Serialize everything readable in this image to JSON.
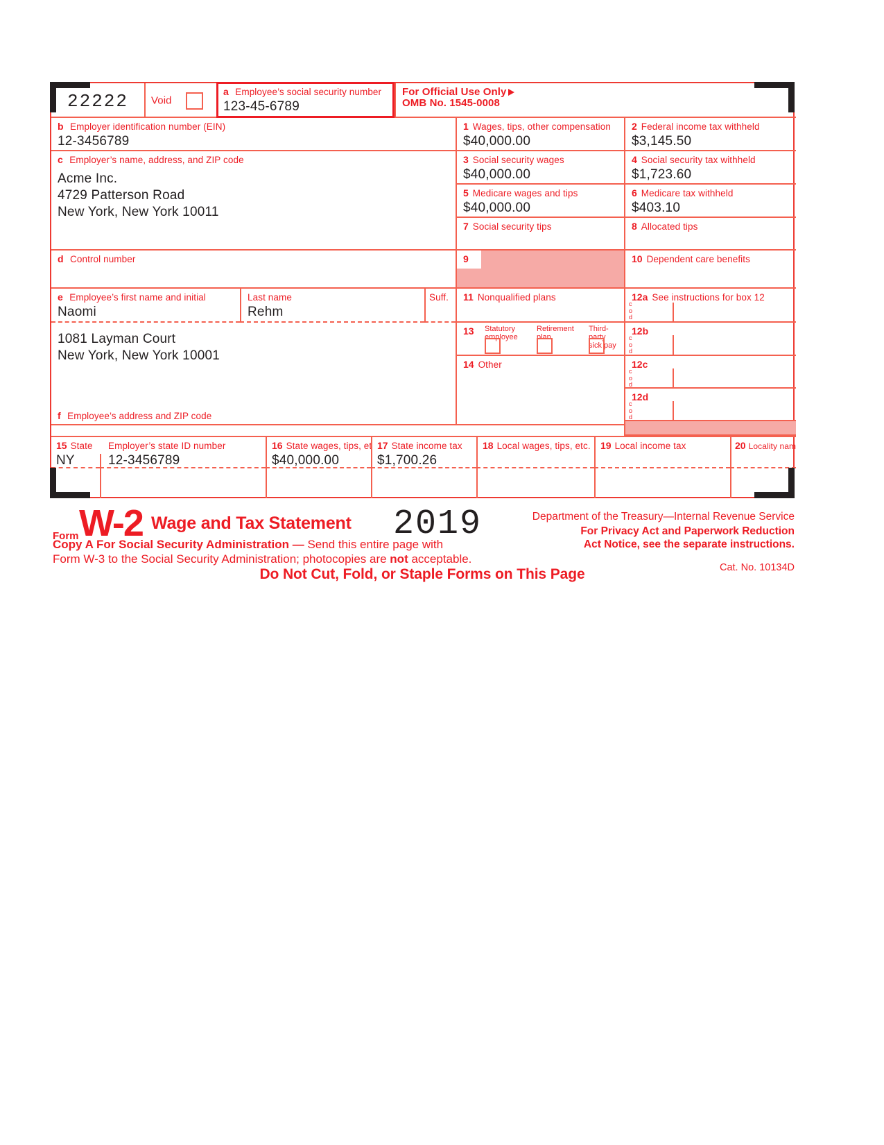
{
  "form": {
    "control_number_ocr": "22222",
    "void_label": "Void",
    "box_a": {
      "label_letter": "a",
      "label": "Employee’s social security number",
      "value": "123-45-6789"
    },
    "official_use": {
      "line1": "For Official Use Only",
      "line2": "OMB No. 1545-0008"
    },
    "box_b": {
      "label_letter": "b",
      "label": "Employer identification number (EIN)",
      "value": "12-3456789"
    },
    "box_c": {
      "label_letter": "c",
      "label": "Employer’s name, address, and ZIP code",
      "value": "Acme Inc.\n4729 Patterson Road\nNew York, New York 10011"
    },
    "box_d": {
      "label_letter": "d",
      "label": "Control number",
      "value": ""
    },
    "box_e": {
      "label_letter": "e",
      "label": "Employee’s first name and initial",
      "value": "Naomi",
      "last_name_label": "Last name",
      "last_name_value": "Rehm",
      "suffix_label": "Suff.",
      "suffix_value": ""
    },
    "employee_address": {
      "value": "1081 Layman Court\nNew York, New York 10001"
    },
    "box_f": {
      "label_letter": "f",
      "label": "Employee’s address and ZIP code"
    },
    "boxes": {
      "b1": {
        "num": "1",
        "label": "Wages, tips, other compensation",
        "value": "$40,000.00"
      },
      "b2": {
        "num": "2",
        "label": "Federal income tax withheld",
        "value": "$3,145.50"
      },
      "b3": {
        "num": "3",
        "label": "Social security wages",
        "value": "$40,000.00"
      },
      "b4": {
        "num": "4",
        "label": "Social security tax withheld",
        "value": "$1,723.60"
      },
      "b5": {
        "num": "5",
        "label": "Medicare wages and tips",
        "value": "$40,000.00"
      },
      "b6": {
        "num": "6",
        "label": "Medicare tax withheld",
        "value": "$403.10"
      },
      "b7": {
        "num": "7",
        "label": "Social security tips",
        "value": ""
      },
      "b8": {
        "num": "8",
        "label": "Allocated tips",
        "value": ""
      },
      "b9": {
        "num": "9",
        "label": "",
        "value": ""
      },
      "b10": {
        "num": "10",
        "label": "Dependent care benefits",
        "value": ""
      },
      "b11": {
        "num": "11",
        "label": "Nonqualified plans",
        "value": ""
      },
      "b12a": {
        "num": "12a",
        "label": "See instructions for box 12",
        "code_label": "code",
        "code": "",
        "value": ""
      },
      "b12b": {
        "num": "12b",
        "label": "",
        "code_label": "code",
        "code": "",
        "value": ""
      },
      "b12c": {
        "num": "12c",
        "label": "",
        "code_label": "code",
        "code": "",
        "value": ""
      },
      "b12d": {
        "num": "12d",
        "label": "",
        "code_label": "code",
        "code": "",
        "value": ""
      },
      "b13": {
        "num": "13",
        "checks": [
          {
            "label": "Statutory\nemployee",
            "checked": false
          },
          {
            "label": "Retirement\nplan",
            "checked": false
          },
          {
            "label": "Third-party\nsick pay",
            "checked": false
          }
        ]
      },
      "b14": {
        "num": "14",
        "label": "Other",
        "value": ""
      },
      "b15": {
        "num": "15",
        "label": "State",
        "state": "NY",
        "employer_state_id_label": "Employer’s state ID number",
        "employer_state_id": "12-3456789",
        "state2": "",
        "employer_state_id2": ""
      },
      "b16": {
        "num": "16",
        "label": "State wages, tips, etc.",
        "value": "$40,000.00",
        "value2": ""
      },
      "b17": {
        "num": "17",
        "label": "State income tax",
        "value": "$1,700.26",
        "value2": ""
      },
      "b18": {
        "num": "18",
        "label": "Local wages, tips, etc.",
        "value": "",
        "value2": ""
      },
      "b19": {
        "num": "19",
        "label": "Local income tax",
        "value": "",
        "value2": ""
      },
      "b20": {
        "num": "20",
        "label": "Locality name",
        "value": "",
        "value2": ""
      }
    }
  },
  "footer": {
    "form_word": "Form",
    "form_number": "W-2",
    "form_title": "Wage and Tax Statement",
    "year": "2019",
    "department": "Department of the Treasury—Internal Revenue Service",
    "privacy_line1": "For Privacy Act and Paperwork Reduction",
    "privacy_line2": "Act Notice, see the separate instructions.",
    "copy_bold": "Copy A For Social Security Administration —",
    "copy_rest": " Send this entire page with",
    "copy_line2_a": "Form W-3 to the Social Security Administration; photocopies are ",
    "copy_line2_bold": "not",
    "copy_line2_b": " acceptable.",
    "cat_no": "Cat. No. 10134D",
    "do_not_cut": "Do Not Cut, Fold, or Staple Forms on This Page"
  },
  "colors": {
    "red": "#ed1c24",
    "red_line": "#f4604f",
    "shade": "#f6aaa6",
    "ink": "#231f20"
  }
}
